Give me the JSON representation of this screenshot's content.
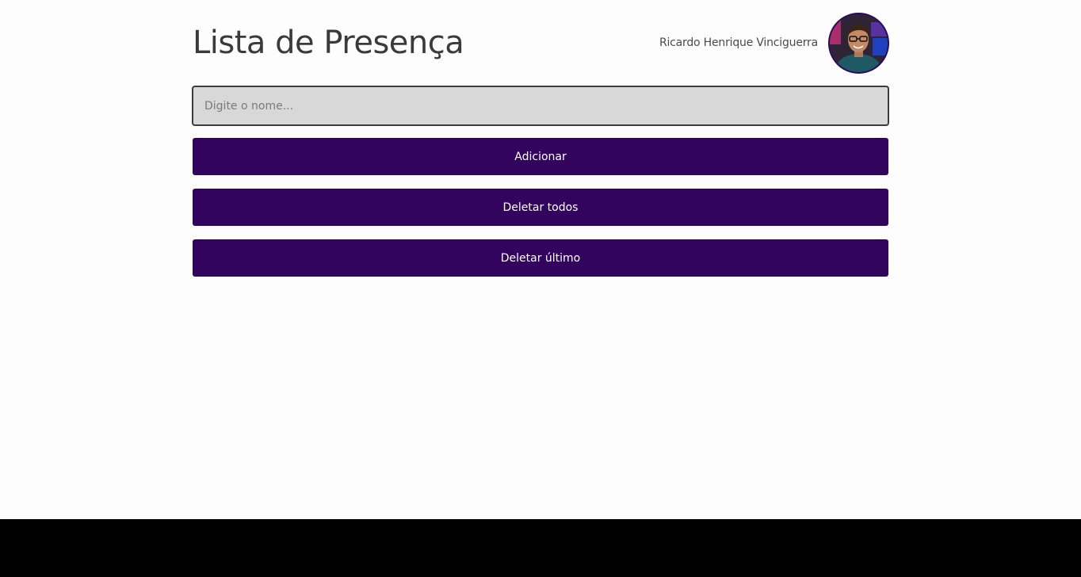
{
  "header": {
    "title": "Lista de Presença",
    "user_name": "Ricardo Henrique Vinciguerra"
  },
  "form": {
    "input_placeholder": "Digite o nome...",
    "input_value": ""
  },
  "buttons": {
    "add_label": "Adicionar",
    "delete_all_label": "Deletar todos",
    "delete_last_label": "Deletar último"
  },
  "colors": {
    "accent": "#32045e",
    "page_background": "#fdfdfd",
    "input_background": "#d8d8d8"
  },
  "icons": {
    "avatar": "user-avatar-photo"
  }
}
